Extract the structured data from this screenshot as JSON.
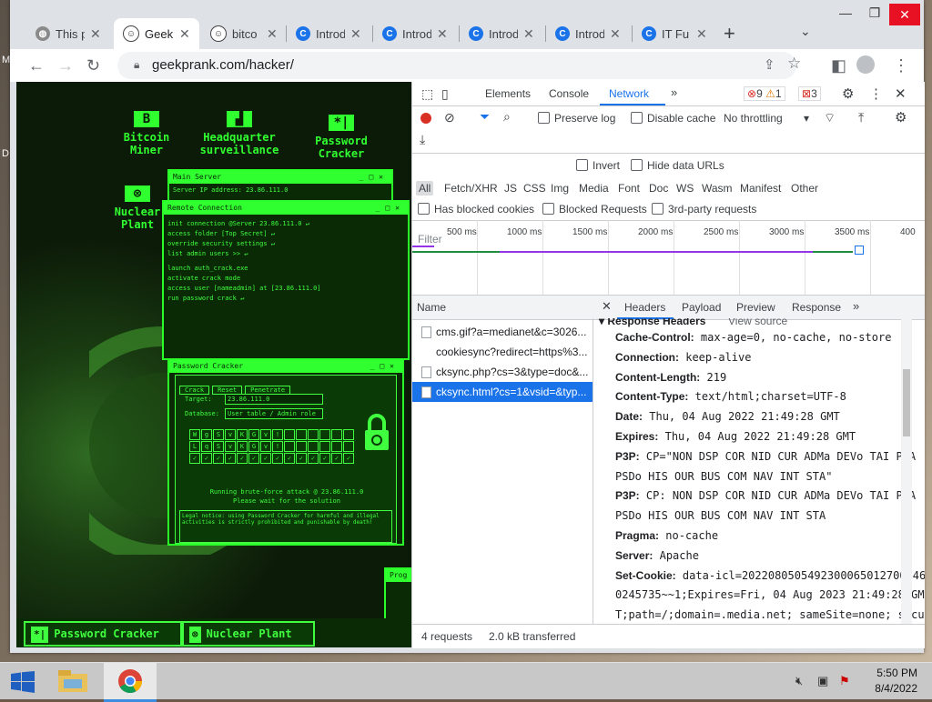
{
  "tabs": [
    {
      "title": "This p",
      "icon": "globe-icon"
    },
    {
      "title": "GeekI",
      "icon": "troll-face-icon"
    },
    {
      "title": "bitco",
      "icon": "troll-face-icon"
    },
    {
      "title": "Introd",
      "icon": "c-logo-icon"
    },
    {
      "title": "Introd",
      "icon": "c-logo-icon"
    },
    {
      "title": "Introd",
      "icon": "c-logo-icon"
    },
    {
      "title": "Introd",
      "icon": "c-logo-icon"
    },
    {
      "title": "IT Fu",
      "icon": "c-logo-icon"
    }
  ],
  "address": {
    "url": "geekprank.com/hacker/"
  },
  "hacker": {
    "desktop_icons": [
      {
        "glyph": "B",
        "label1": "Bitcoin",
        "label2": "Miner"
      },
      {
        "glyph": "",
        "label1": "Headquarter",
        "label2": "surveillance"
      },
      {
        "glyph": "*|",
        "label1": "Password",
        "label2": "Cracker"
      },
      {
        "glyph": "",
        "label1": "Nuclear",
        "label2": "Plant"
      }
    ],
    "main_server": {
      "title": "Main Server",
      "line": "Server IP address: 23.86.111.0"
    },
    "remote": {
      "title": "Remote Connection",
      "lines": [
        "init connection @Server 23.86.111.0",
        "access folder [Top Secret]",
        "override security settings",
        "list admin users >>",
        "launch auth_crack.exe",
        "activate crack mode",
        "access user [nameadmin] at [23.86.111.0]",
        "run password crack"
      ]
    },
    "cracker": {
      "title": "Password Cracker",
      "buttons": [
        "Crack",
        "Reset",
        "Penetrate"
      ],
      "target_label": "Target:",
      "target_value": "23.86.111.0",
      "database_label": "Database:",
      "database_value": "User table / Admin role",
      "grid": [
        [
          "W",
          "g",
          "S",
          "v",
          "K",
          "G",
          "v",
          "!",
          "",
          "",
          "",
          "",
          "",
          ""
        ],
        [
          "L",
          "q",
          "S",
          "v",
          "K",
          "G",
          "v",
          "!",
          "",
          "",
          "",
          "",
          "",
          ""
        ],
        [
          "✓",
          "✓",
          "✓",
          "✓",
          "✓",
          "✓",
          "✓",
          "✓",
          "✓",
          "✓",
          "✓",
          "✓",
          "✓",
          "✓"
        ]
      ],
      "status1": "Running brute-force attack @ 23.86.111.0",
      "status2": "Please wait for the solution",
      "legal": "Legal notice: using Password Cracker for harmful and illegal activities is strictly prohibited and punishable by death!"
    },
    "prog_label": "Prog",
    "taskbar": [
      {
        "glyph": "*|",
        "label": "Password Cracker"
      },
      {
        "glyph": "⊗",
        "label": "Nuclear Plant"
      }
    ]
  },
  "devtools": {
    "tabs": [
      "Elements",
      "Console",
      "Network"
    ],
    "active_tab": "Network",
    "errors": "9",
    "warnings": "1",
    "issues": "3",
    "preserve_log": "Preserve log",
    "disable_cache": "Disable cache",
    "throttling": "No throttling",
    "filter_placeholder": "Filter",
    "invert": "Invert",
    "hide_data_urls": "Hide data URLs",
    "types": [
      "All",
      "Fetch/XHR",
      "JS",
      "CSS",
      "Img",
      "Media",
      "Font",
      "Doc",
      "WS",
      "Wasm",
      "Manifest",
      "Other"
    ],
    "has_blocked": "Has blocked cookies",
    "blocked_requests": "Blocked Requests",
    "third_party": "3rd-party requests",
    "ticks": [
      "500 ms",
      "1000 ms",
      "1500 ms",
      "2000 ms",
      "2500 ms",
      "3000 ms",
      "3500 ms",
      "400"
    ],
    "name_header": "Name",
    "requests": [
      "cms.gif?a=medianet&c=3026...",
      "cookiesync?redirect=https%3...",
      "cksync.php?cs=3&type=doc&...",
      "cksync.html?cs=1&vsid=&typ..."
    ],
    "detail_tabs": [
      "Headers",
      "Payload",
      "Preview",
      "Response"
    ],
    "section": "Response Headers",
    "view_source": "View source",
    "headers": [
      {
        "k": "Cache-Control:",
        "v": "max-age=0, no-cache, no-store"
      },
      {
        "k": "Connection:",
        "v": "keep-alive"
      },
      {
        "k": "Content-Length:",
        "v": "219"
      },
      {
        "k": "Content-Type:",
        "v": "text/html;charset=UTF-8"
      },
      {
        "k": "Date:",
        "v": "Thu, 04 Aug 2022 21:49:28 GMT"
      },
      {
        "k": "Expires:",
        "v": "Thu, 04 Aug 2022 21:49:28 GMT"
      },
      {
        "k": "P3P:",
        "v": "CP=\"NON DSP COR NID CUR ADMa DEVo TAI PSA"
      },
      {
        "k": "",
        "v": "PSDo HIS OUR BUS COM NAV INT STA\""
      },
      {
        "k": "P3P:",
        "v": "CP: NON DSP COR NID CUR ADMa DEVo TAI PSA"
      },
      {
        "k": "",
        "v": "PSDo HIS OUR BUS COM NAV INT STA"
      },
      {
        "k": "Pragma:",
        "v": "no-cache"
      },
      {
        "k": "Server:",
        "v": "Apache"
      },
      {
        "k": "Set-Cookie:",
        "v": "data-icl=2022080505492300065012700146"
      },
      {
        "k": "",
        "v": "0245735~~1;Expires=Fri, 04 Aug 2023 21:49:28 GM"
      },
      {
        "k": "",
        "v": "T;path=/;domain=.media.net; sameSite=none; secu"
      }
    ],
    "status_requests": "4 requests",
    "status_transferred": "2.0 kB transferred"
  },
  "clock": {
    "time": "5:50 PM",
    "date": "8/4/2022"
  }
}
